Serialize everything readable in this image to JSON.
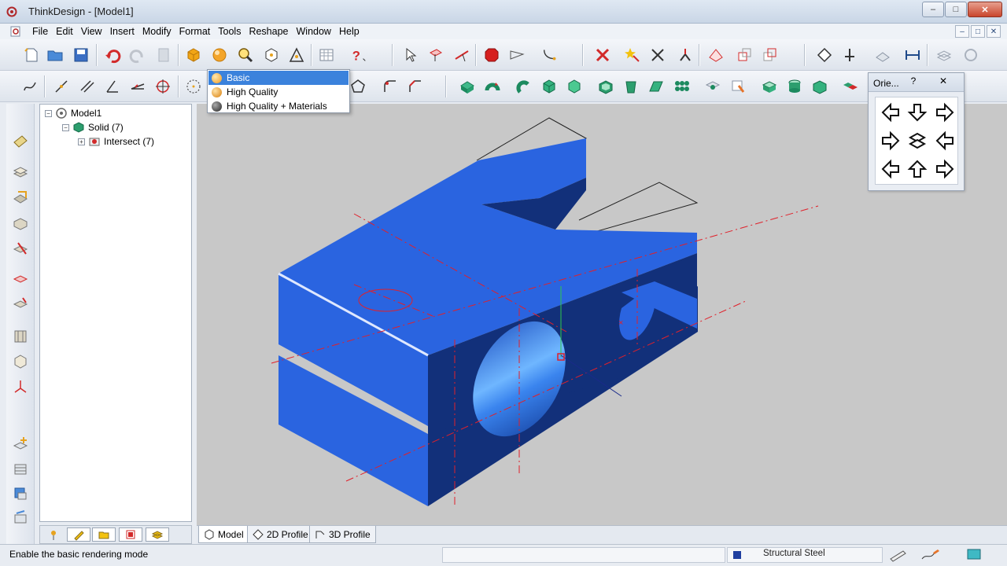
{
  "window": {
    "title": "ThinkDesign - [Model1]",
    "min": "–",
    "max": "□",
    "close": "✕"
  },
  "menu": [
    "File",
    "Edit",
    "View",
    "Insert",
    "Modify",
    "Format",
    "Tools",
    "Reshape",
    "Window",
    "Help"
  ],
  "mdi_buttons": [
    "–",
    "□",
    "✕"
  ],
  "tree": {
    "root": "Model1",
    "solid": "Solid (7)",
    "intersect": "Intersect (7)",
    "toggle_minus": "−",
    "toggle_plus": "+"
  },
  "view_tabs": [
    "Model",
    "2D Profile",
    "3D Profile"
  ],
  "status": {
    "message": "Enable the basic rendering mode",
    "material": "Structural Steel"
  },
  "render_menu": {
    "items": [
      "Basic",
      "High Quality",
      "High Quality + Materials"
    ],
    "selected": "Basic"
  },
  "orientation": {
    "title": "Orie...",
    "help": "?",
    "close": "✕"
  },
  "colors": {
    "model_blue": "#2a64e0",
    "model_dark": "#12307a",
    "selection": "#3b82dc",
    "axis_red": "#e0202a"
  }
}
